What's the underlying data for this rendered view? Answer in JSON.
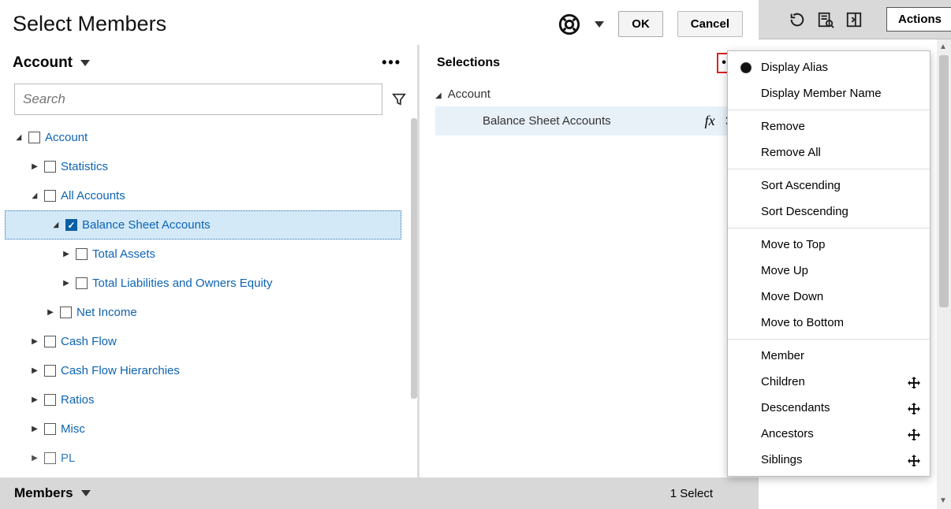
{
  "title": "Select Members",
  "buttons": {
    "ok": "OK",
    "cancel": "Cancel"
  },
  "back_toolbar": {
    "actions": "Actions"
  },
  "dimension": {
    "label": "Account"
  },
  "search": {
    "placeholder": "Search"
  },
  "tree": {
    "root": "Account",
    "n0": "Statistics",
    "n1": "All Accounts",
    "n2": "Balance Sheet Accounts",
    "n3": "Total Assets",
    "n4": "Total Liabilities and Owners Equity",
    "n5": "Net Income",
    "n6": "Cash Flow",
    "n7": "Cash Flow Hierarchies",
    "n8": "Ratios",
    "n9": "Misc",
    "n10": "PL"
  },
  "selections": {
    "header": "Selections",
    "root": "Account",
    "item0": "Balance Sheet Accounts",
    "count_label": "1 Select"
  },
  "footer": {
    "label": "Members"
  },
  "menu": {
    "display_alias": "Display Alias",
    "display_member": "Display Member Name",
    "remove": "Remove",
    "remove_all": "Remove All",
    "sort_asc": "Sort Ascending",
    "sort_desc": "Sort Descending",
    "move_top": "Move to Top",
    "move_up": "Move Up",
    "move_down": "Move Down",
    "move_bottom": "Move to Bottom",
    "member": "Member",
    "children": "Children",
    "descendants": "Descendants",
    "ancestors": "Ancestors",
    "siblings": "Siblings"
  }
}
